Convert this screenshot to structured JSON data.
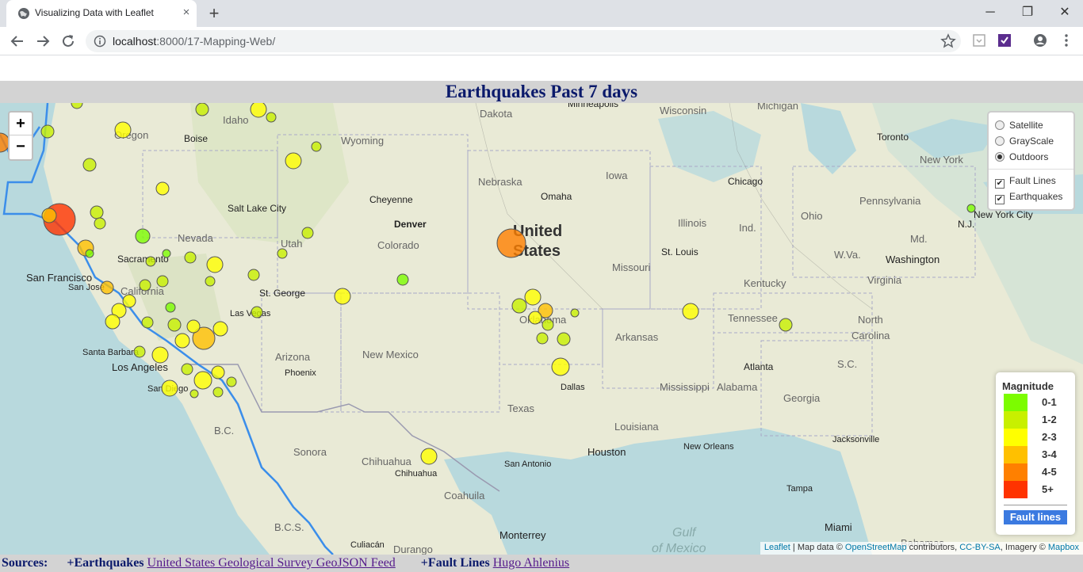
{
  "browser": {
    "tab_title": "Visualizing Data with Leaflet",
    "tab_close": "×",
    "new_tab": "+",
    "url_host": "localhost",
    "url_path": ":8000/17-Mapping-Web/",
    "window_minimize": "─",
    "window_restore": "❐",
    "window_close": "✕"
  },
  "page": {
    "title": "Earthquakes Past 7 days"
  },
  "map": {
    "zoom_in": "+",
    "zoom_out": "−",
    "layers": {
      "base": [
        {
          "label": "Satellite",
          "selected": false
        },
        {
          "label": "GrayScale",
          "selected": false
        },
        {
          "label": "Outdoors",
          "selected": true
        }
      ],
      "overlays": [
        {
          "label": "Fault Lines",
          "checked": true
        },
        {
          "label": "Earthquakes",
          "checked": true
        }
      ]
    },
    "legend": {
      "title": "Magnitude",
      "items": [
        {
          "label": "0-1",
          "color": "#7cfc00"
        },
        {
          "label": "1-2",
          "color": "#c8f000"
        },
        {
          "label": "2-3",
          "color": "#ffff00"
        },
        {
          "label": "3-4",
          "color": "#ffc000"
        },
        {
          "label": "4-5",
          "color": "#ff8000"
        },
        {
          "label": "5+",
          "color": "#ff3300"
        }
      ],
      "fault_label": "Fault lines",
      "fault_color": "#3b7ae0"
    },
    "attribution": {
      "leaflet": "Leaflet",
      "sep1": " | Map data © ",
      "osm": "OpenStreetMap",
      "sep2": " contributors, ",
      "license": "CC-BY-SA",
      "sep3": ", Imagery © ",
      "mapbox": "Mapbox"
    },
    "labels": {
      "dakota": "Dakota",
      "minneapolis": "Minneapolis",
      "wisconsin": "Wisconsin",
      "michigan": "Michigan",
      "toronto": "Toronto",
      "idaho": "Idaho",
      "oregon": "Oregon",
      "boise": "Boise",
      "wyoming": "Wyoming",
      "new_york": "New York",
      "nebraska": "Nebraska",
      "iowa": "Iowa",
      "chicago": "Chicago",
      "cheyenne": "Cheyenne",
      "omaha": "Omaha",
      "pennsylvania": "Pennsylvania",
      "salt_lake_city": "Salt Lake City",
      "illinois": "Illinois",
      "ohio": "Ohio",
      "new_york_city": "New York City",
      "nj": "N.J.",
      "denver": "Denver",
      "nevada": "Nevada",
      "united": "United",
      "states": "States",
      "ind": "Ind.",
      "md": "Md.",
      "utah": "Utah",
      "colorado": "Colorado",
      "sacramento": "Sacramento",
      "st_louis": "St. Louis",
      "wva": "W.Va.",
      "washington": "Washington",
      "san_francisco": "San Francisco",
      "san_jose": "San Jose",
      "missouri": "Missouri",
      "california": "California",
      "st_george": "St. George",
      "kentucky": "Kentucky",
      "virginia": "Virginia",
      "las_vegas": "Las Vegas",
      "oklahoma": "Oklahoma",
      "tennessee": "Tennessee",
      "north_carolina_1": "North",
      "north_carolina_2": "Carolina",
      "arkansas": "Arkansas",
      "santa_barbara": "Santa Barbara",
      "arizona": "Arizona",
      "new_mexico": "New Mexico",
      "los_angeles": "Los Angeles",
      "phoenix": "Phoenix",
      "atlanta": "Atlanta",
      "sc": "S.C.",
      "san_diego": "San Diego",
      "dallas": "Dallas",
      "mississippi": "Mississippi",
      "alabama": "Alabama",
      "georgia": "Georgia",
      "texas": "Texas",
      "bc": "B.C.",
      "louisiana": "Louisiana",
      "jacksonville": "Jacksonville",
      "sonora": "Sonora",
      "houston": "Houston",
      "new_orleans": "New Orleans",
      "chihuahua_state": "Chihuahua",
      "chihuahua_city": "Chihuahua",
      "san_antonio": "San Antonio",
      "coahuila": "Coahuila",
      "tampa": "Tampa",
      "bcs": "B.C.S.",
      "culiacan": "Culiacán",
      "durango": "Durango",
      "monterrey": "Monterrey",
      "miami": "Miami",
      "gulf": "Gulf",
      "of_mexico": "of Mexico",
      "bahamas": "Bahamas"
    }
  },
  "sources": {
    "label": "Sources:",
    "eq_prefix": "+Earthquakes",
    "eq_link": "United States Geological Survey GeoJSON Feed",
    "fault_prefix": "+Fault Lines",
    "fault_link": "Hugo Ahlenius"
  }
}
